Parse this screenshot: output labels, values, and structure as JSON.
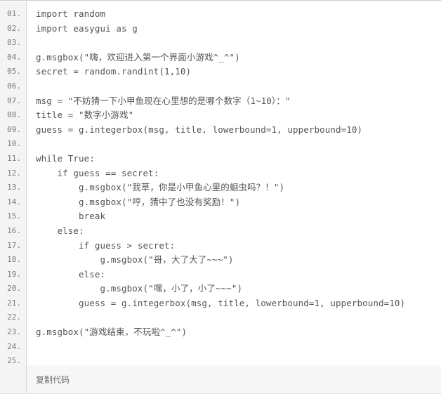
{
  "code_block": {
    "language": "python",
    "gutter_suffix": ".",
    "line_numbers": [
      "01",
      "02",
      "03",
      "04",
      "05",
      "06",
      "07",
      "08",
      "09",
      "10",
      "11",
      "12",
      "13",
      "14",
      "15",
      "16",
      "17",
      "18",
      "19",
      "20",
      "21",
      "22",
      "23",
      "24",
      "25"
    ],
    "lines": [
      "import random",
      "import easygui as g",
      "",
      "g.msgbox(\"嗨，欢迎进入第一个界面小游戏^_^\")",
      "secret = random.randint(1,10)",
      "",
      "msg = \"不妨猜一下小甲鱼现在心里想的是哪个数字（1~10）：\"",
      "title = \"数字小游戏\"",
      "guess = g.integerbox(msg, title, lowerbound=1, upperbound=10)",
      "",
      "while True:",
      "    if guess == secret:",
      "        g.msgbox(\"我草，你是小甲鱼心里的蛔虫吗？！\")",
      "        g.msgbox(\"哼，猜中了也没有奖励！\")",
      "        break",
      "    else:",
      "        if guess > secret:",
      "            g.msgbox(\"哥，大了大了~~~\")",
      "        else:",
      "            g.msgbox(\"嘿，小了，小了~~~\")",
      "        guess = g.integerbox(msg, title, lowerbound=1, upperbound=10)",
      "",
      "g.msgbox(\"游戏结束，不玩啦^_^\")",
      "",
      ""
    ],
    "footer": {
      "copy_label": "复制代码"
    },
    "colors": {
      "code_text": "#555555",
      "line_number_text": "#7b7b7b",
      "code_background": "#ffffff",
      "gutter_background": "#f4f4f4",
      "footer_background": "#f7f7f7",
      "border": "#d6d6d6",
      "copy_link_text": "#666666"
    }
  }
}
